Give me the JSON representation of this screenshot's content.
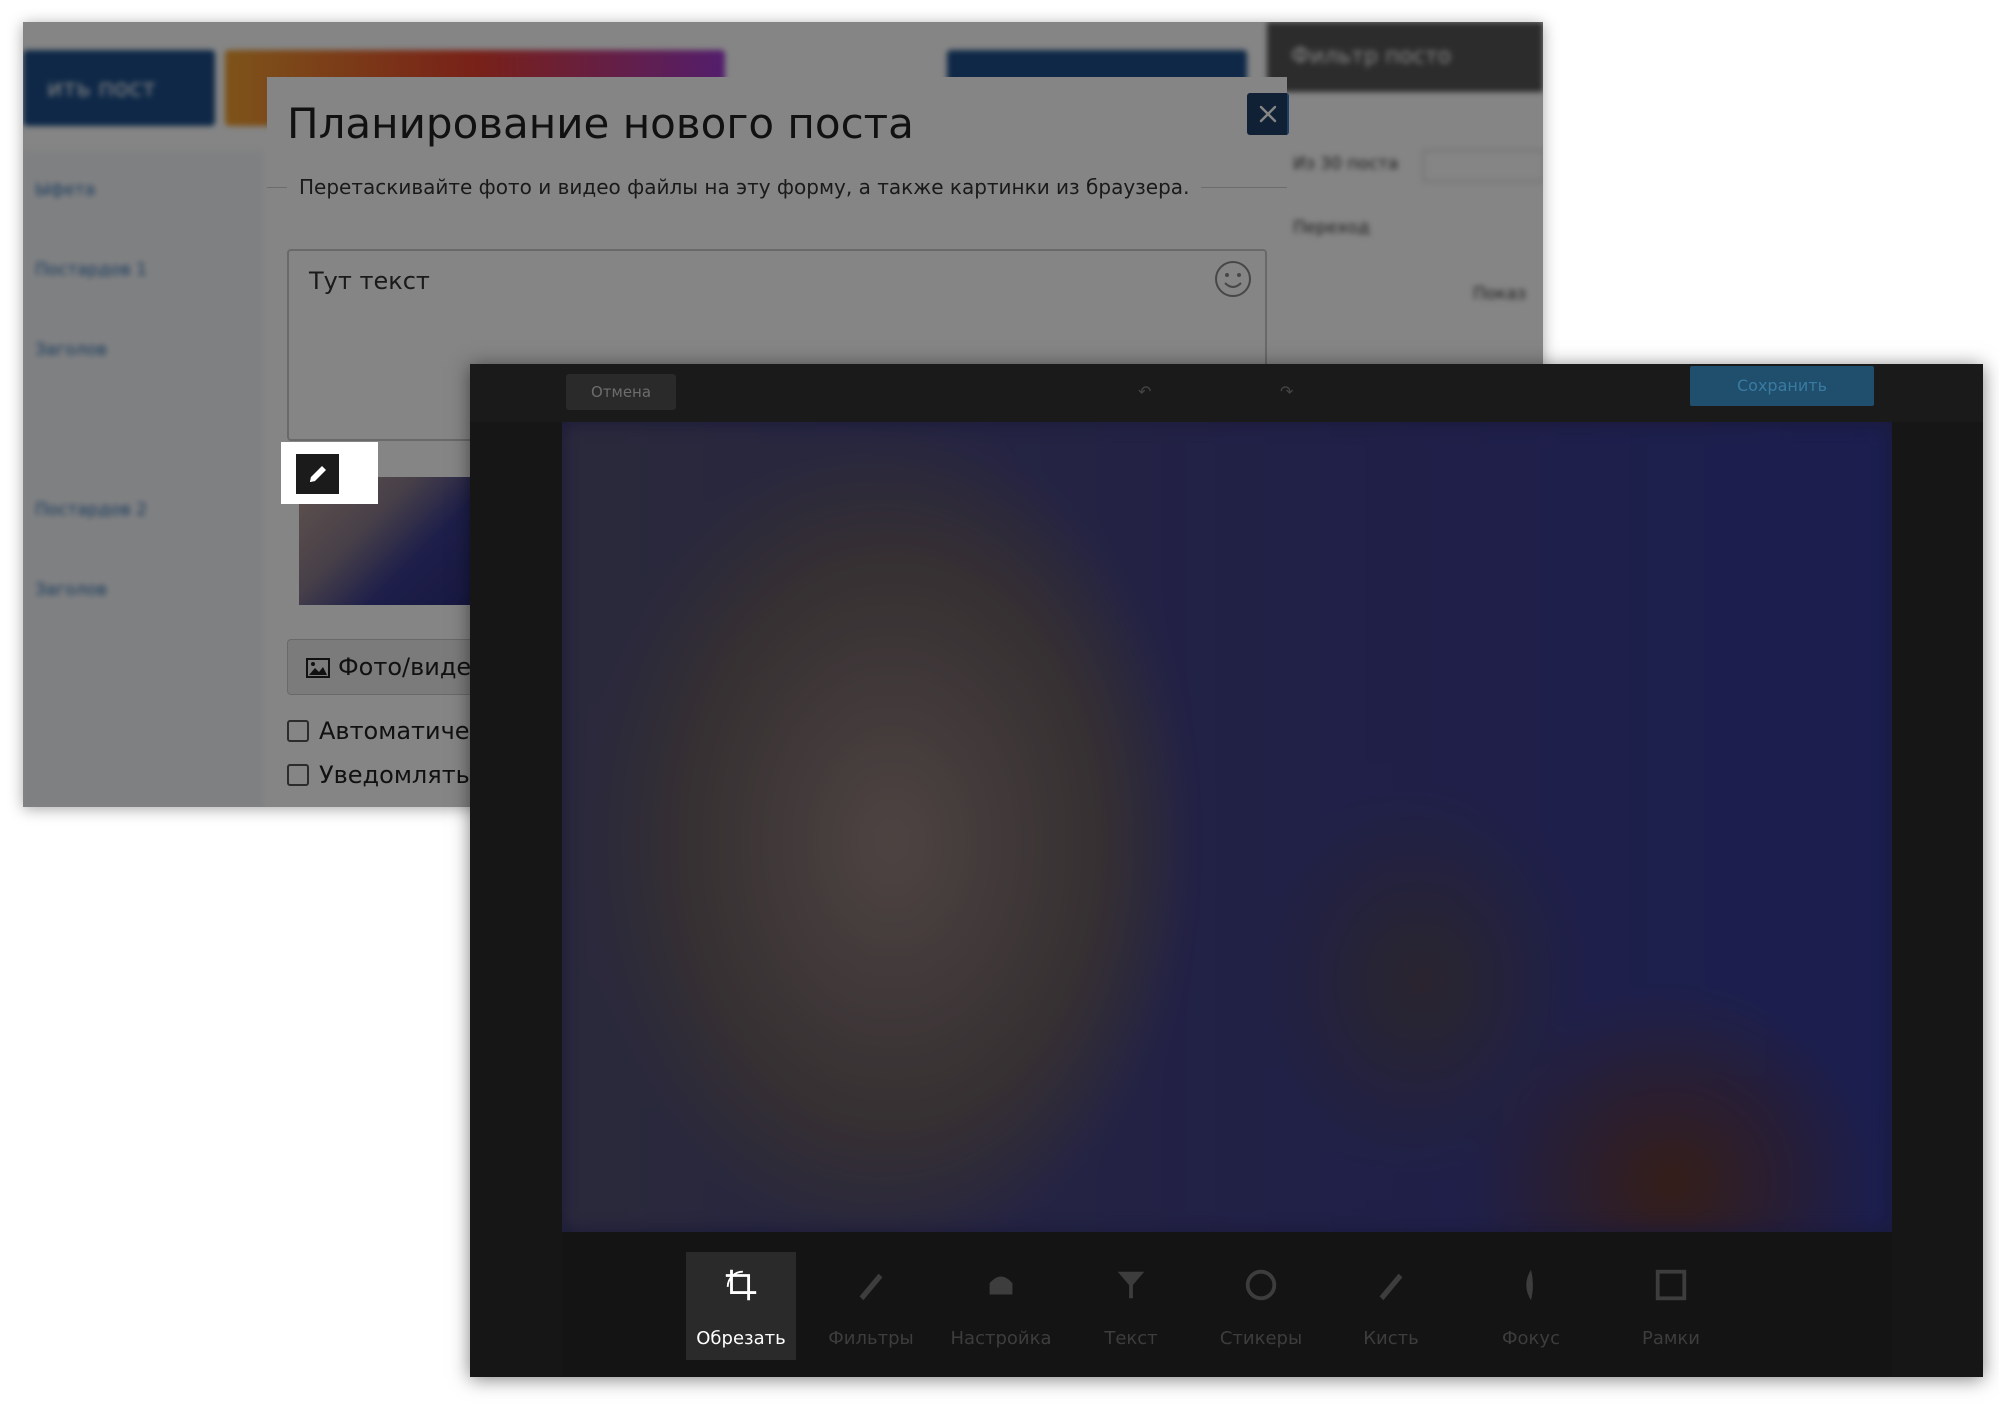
{
  "background_app": {
    "buttons": [
      "ить пост",
      "",
      "",
      "Фильтр посто"
    ],
    "sidebar_items": [
      "Ыфета",
      "Заголов",
      "Постардов 1",
      "Заголов",
      "Постардов 2"
    ],
    "right_labels": [
      "Из 30 поста",
      "Переход",
      "Показ"
    ]
  },
  "modal": {
    "title": "Планирование нового поста",
    "hint": "Перетаскивайте фото и видео файлы на эту форму, а также картинки из браузера.",
    "text_value": "Тут текст",
    "media_button_label": "Фото/виде",
    "checkbox_auto_label": "Автоматичес",
    "checkbox_notify_label": "Уведомлять"
  },
  "editor": {
    "top_left_label": "Отмена",
    "top_mid_labels": [
      "",
      ""
    ],
    "top_right_label": "Сохранить",
    "tools": [
      {
        "label": "Обрезать",
        "icon": "crop-icon",
        "active": true
      },
      {
        "label": "Фильтры",
        "icon": "pencil-icon",
        "active": false
      },
      {
        "label": "Настройка",
        "icon": "adjust-icon",
        "active": false
      },
      {
        "label": "Текст",
        "icon": "filter-icon",
        "active": false
      },
      {
        "label": "Стикеры",
        "icon": "sticker-icon",
        "active": false
      },
      {
        "label": "Кисть",
        "icon": "brush-icon",
        "active": false
      },
      {
        "label": "Фокус",
        "icon": "focus-icon",
        "active": false
      },
      {
        "label": "Рамки",
        "icon": "frame-icon",
        "active": false
      }
    ]
  },
  "colors": {
    "primary": "#1d4e89",
    "close_button": "#1f3f66",
    "editor_bg": "#141414",
    "active_tool_bg": "#2a2a2a"
  }
}
